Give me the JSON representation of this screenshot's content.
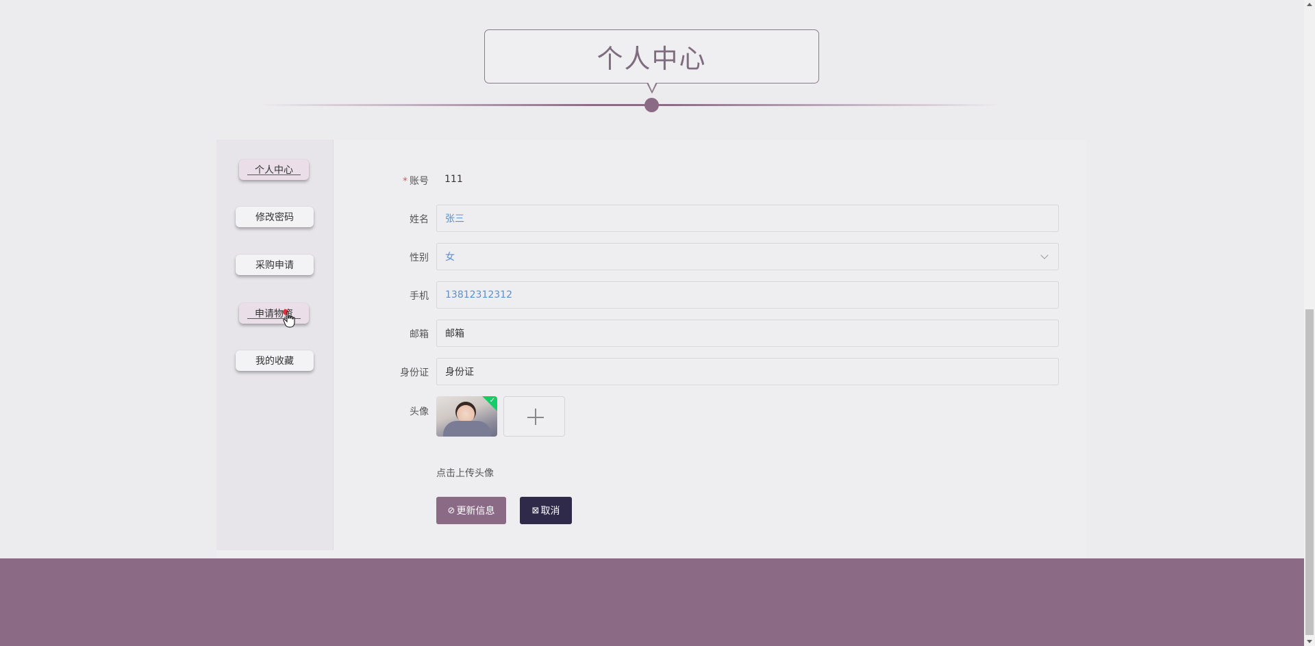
{
  "header": {
    "title": "个人中心"
  },
  "sidebar": {
    "items": [
      {
        "label": "个人中心"
      },
      {
        "label": "修改密码"
      },
      {
        "label": "采购申请"
      },
      {
        "label": "申请物资"
      },
      {
        "label": "我的收藏"
      }
    ]
  },
  "form": {
    "account": {
      "label": "账号",
      "required_mark": "*",
      "value": "111"
    },
    "name": {
      "label": "姓名",
      "value": "张三"
    },
    "gender": {
      "label": "性别",
      "value": "女"
    },
    "phone": {
      "label": "手机",
      "value": "13812312312"
    },
    "email": {
      "label": "邮箱",
      "value": "邮箱"
    },
    "id_card": {
      "label": "身份证",
      "value": "身份证"
    },
    "avatar": {
      "label": "头像",
      "hint": "点击上传头像"
    }
  },
  "actions": {
    "update_label": "更新信息",
    "cancel_label": "取消"
  },
  "colors": {
    "accent": "#8a6a84",
    "dark_button": "#2f2a4a",
    "link_blue": "#5a8fd0",
    "success_green": "#13ce66"
  }
}
